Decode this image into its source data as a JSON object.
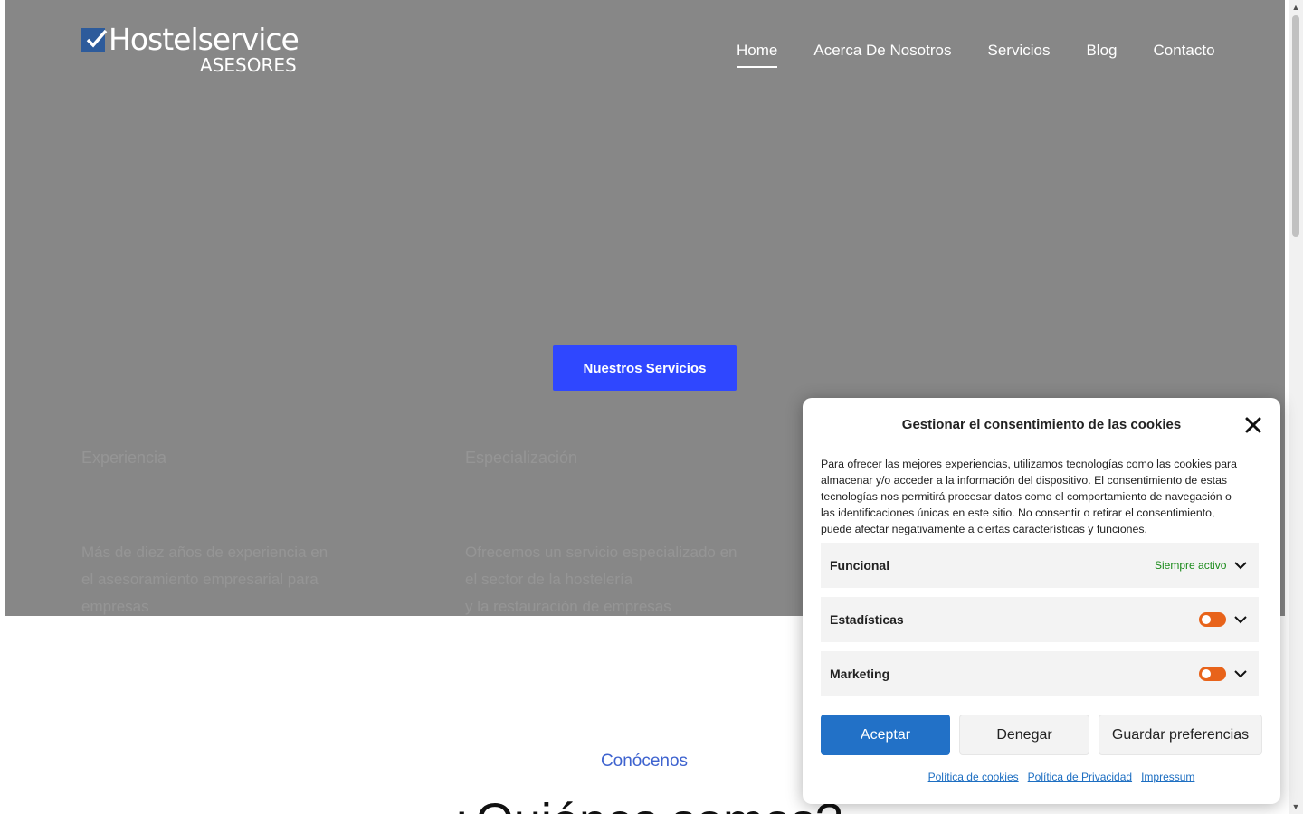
{
  "logo": {
    "title": "Hostelservice",
    "subtitle": "ASESORES"
  },
  "nav": {
    "items": [
      {
        "label": "Home",
        "active": true
      },
      {
        "label": "Acerca De Nosotros",
        "active": false
      },
      {
        "label": "Servicios",
        "active": false
      },
      {
        "label": "Blog",
        "active": false
      },
      {
        "label": "Contacto",
        "active": false
      }
    ]
  },
  "hero": {
    "cta_label": "Nuestros Servicios",
    "overlay_color": "#878787",
    "cta_color": "#2f47ff",
    "faded_headings": [
      "Experiencia",
      "Especialización"
    ],
    "faded_paragraphs": [
      [
        "Más de diez años de experiencia en",
        "el asesoramiento empresarial para",
        "empresas"
      ],
      [
        "Ofrecemos un servicio especializado en",
        "el sector de la hostelería",
        "y la restauración de empresas"
      ]
    ]
  },
  "section": {
    "eyebrow": "Conócenos",
    "title": "¿Quiénes somos?"
  },
  "cookie": {
    "title": "Gestionar el consentimiento de las cookies",
    "text": "Para ofrecer las mejores experiencias, utilizamos tecnologías como las cookies para almacenar y/o acceder a la información del dispositivo. El consentimiento de estas tecnologías nos permitirá procesar datos como el comportamiento de navegación o las identificaciones únicas en este sitio. No consentir o retirar el consentimiento, puede afectar negativamente a ciertas características y funciones.",
    "categories": [
      {
        "label": "Funcional",
        "status": "Siempre activo"
      },
      {
        "label": "Estadísticas",
        "status": ""
      },
      {
        "label": "Marketing",
        "status": ""
      }
    ],
    "accept_label": "Aceptar",
    "deny_label": "Denegar",
    "save_label": "Guardar preferencias",
    "links": [
      "Política de cookies",
      "Política de Privacidad",
      "Impressum"
    ],
    "accent": "#2271c7",
    "toggle_color": "#e8631a",
    "always_active_color": "#1a8a1a"
  }
}
